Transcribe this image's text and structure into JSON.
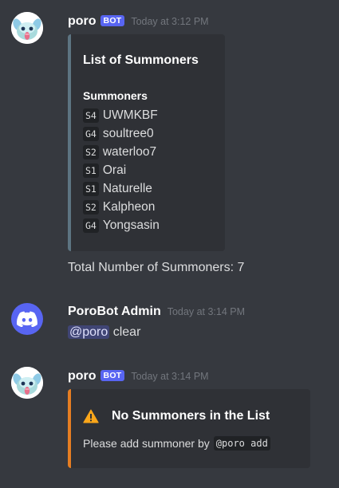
{
  "messages": [
    {
      "username": "poro",
      "bot_tag": "BOT",
      "timestamp": "Today at 3:12 PM",
      "embed": {
        "title": "List of Summoners",
        "field_name": "Summoners",
        "summoners": [
          {
            "tier": "S4",
            "name": "UWMKBF"
          },
          {
            "tier": "G4",
            "name": "soultree0"
          },
          {
            "tier": "S2",
            "name": "waterloo7"
          },
          {
            "tier": "S1",
            "name": "Orai"
          },
          {
            "tier": "S1",
            "name": "Naturelle"
          },
          {
            "tier": "S2",
            "name": "Kalpheon"
          },
          {
            "tier": "G4",
            "name": "Yongsasin"
          }
        ]
      },
      "footer_text": "Total Number of Summoners: 7"
    },
    {
      "username": "PoroBot Admin",
      "timestamp": "Today at 3:14 PM",
      "mention": "@poro",
      "content": "clear"
    },
    {
      "username": "poro",
      "bot_tag": "BOT",
      "timestamp": "Today at 3:14 PM",
      "embed": {
        "icon": "warning-icon",
        "title": "No Summoners in the List",
        "description": "Please add summoner by",
        "command": "@poro add"
      }
    }
  ],
  "colors": {
    "background": "#36393f",
    "embed_background": "#2f3136",
    "bot_tag": "#5865f2",
    "summoners_embed_border": "#5d7482",
    "warning_embed_border": "#e67e22",
    "warning_icon": "#faa61a",
    "timestamp": "#72767d"
  }
}
